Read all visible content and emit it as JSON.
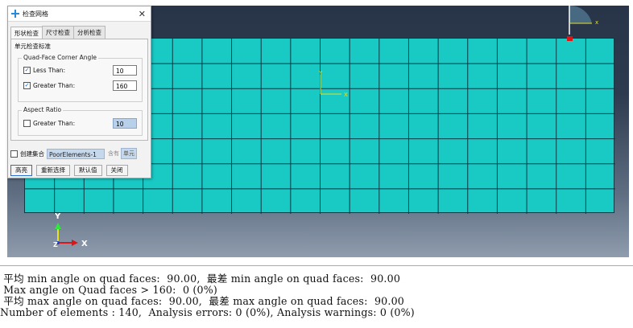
{
  "dialog": {
    "title": "检查网格",
    "tabs": [
      {
        "label": "形状检查",
        "active": true
      },
      {
        "label": "尺寸检查",
        "active": false
      },
      {
        "label": "分析检查",
        "active": false
      }
    ],
    "criteria_label": "单元检查标准",
    "quad_group": {
      "title": "Quad-Face Corner Angle",
      "less_than": {
        "label": "Less Than:",
        "checked": true,
        "value": "10"
      },
      "greater_than": {
        "label": "Greater Than:",
        "checked": true,
        "value": "160"
      }
    },
    "aspect_group": {
      "title": "Aspect Ratio",
      "greater_than": {
        "label": "Greater Than:",
        "checked": false,
        "value": "10"
      }
    },
    "create_set": {
      "label": "创建集合",
      "checked": false,
      "name": "PoorElements-1",
      "contains_label": "含有",
      "element_type": "单元"
    },
    "buttons": {
      "highlight": "高亮",
      "reselect": "重新选择",
      "defaults": "默认值",
      "close": "关闭"
    }
  },
  "viewport": {
    "mesh_color": "#19c9c4",
    "mesh_cols": 20,
    "mesh_rows": 7,
    "triad_labels": {
      "y": "Y",
      "z": "Z",
      "x": "X"
    },
    "mini_triad_labels": {
      "y": "Y",
      "x": "X"
    }
  },
  "output": {
    "lines": [
      " 平均 min angle on quad faces:  90.00,  最差 min angle on quad faces:  90.00",
      " Max angle on Quad faces > 160:  0 (0%)",
      " 平均 max angle on quad faces:  90.00,  最差 max angle on quad faces:  90.00",
      "Number of elements : 140,  Analysis errors: 0 (0%), Analysis warnings: 0 (0%)"
    ]
  }
}
